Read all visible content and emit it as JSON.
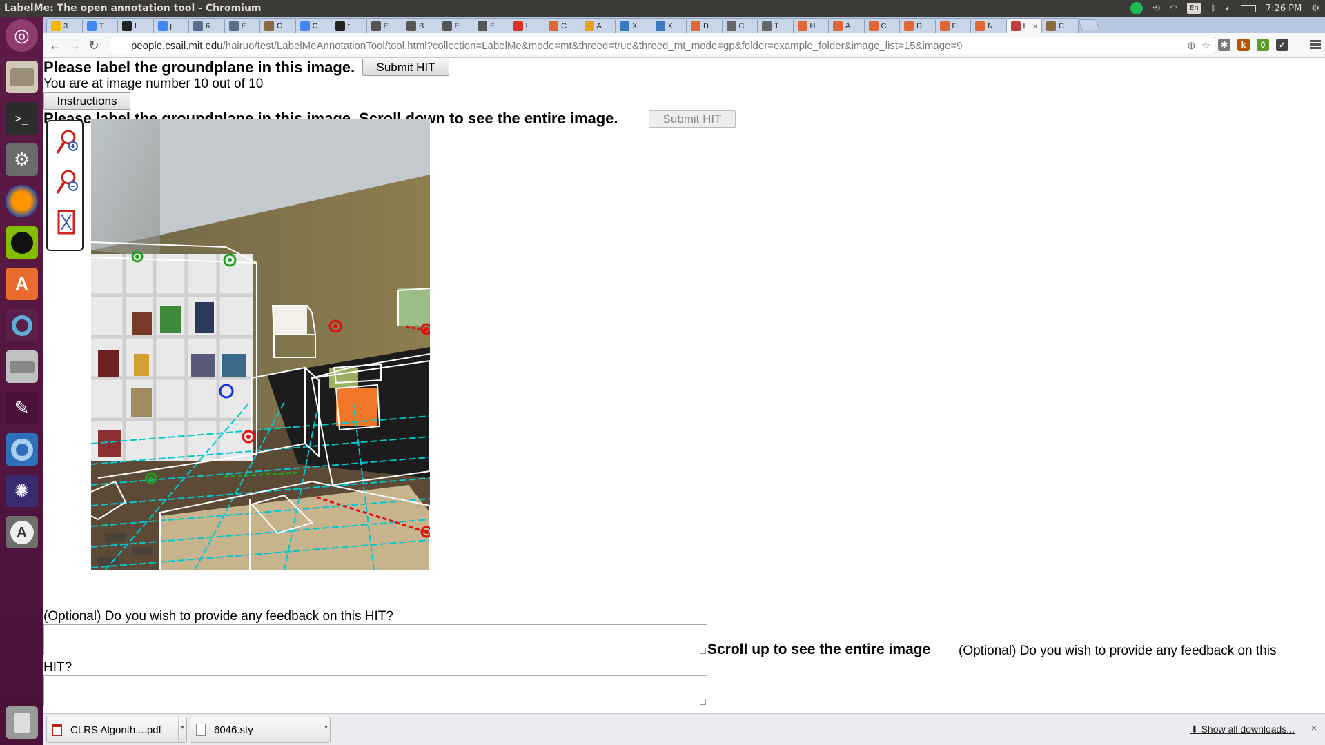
{
  "window": {
    "title": "LabelMe: The open annotation tool - Chromium",
    "clock": "7:26 PM",
    "keyboard_layout": "En"
  },
  "launcher": {
    "items": [
      "ubuntu-dash",
      "files",
      "terminal",
      "system-settings",
      "firefox",
      "spotify",
      "software-center",
      "unity-tweak",
      "disks",
      "text-editor",
      "chromium",
      "shotwell",
      "software-updater",
      "trash"
    ]
  },
  "tabs": [
    {
      "label": "3",
      "favicon": "drive"
    },
    {
      "label": "T",
      "favicon": "docs"
    },
    {
      "label": "L",
      "favicon": "github"
    },
    {
      "label": "j",
      "favicon": "docs"
    },
    {
      "label": "6",
      "favicon": "bookmark"
    },
    {
      "label": "E",
      "favicon": "bookmark"
    },
    {
      "label": "C",
      "favicon": "misc"
    },
    {
      "label": "C",
      "favicon": "docs"
    },
    {
      "label": "t",
      "favicon": "github"
    },
    {
      "label": "E",
      "favicon": "wiki"
    },
    {
      "label": "B",
      "favicon": "wiki"
    },
    {
      "label": "E",
      "favicon": "wiki"
    },
    {
      "label": "E",
      "favicon": "wiki"
    },
    {
      "label": "I",
      "favicon": "gmail"
    },
    {
      "label": "C",
      "favicon": "matlab"
    },
    {
      "label": "A",
      "favicon": "orange"
    },
    {
      "label": "X",
      "favicon": "w3"
    },
    {
      "label": "X",
      "favicon": "w3"
    },
    {
      "label": "D",
      "favicon": "matlab"
    },
    {
      "label": "C",
      "favicon": "wikipedia"
    },
    {
      "label": "T",
      "favicon": "wikipedia"
    },
    {
      "label": "H",
      "favicon": "matlab"
    },
    {
      "label": "A",
      "favicon": "matlab"
    },
    {
      "label": "C",
      "favicon": "matlab"
    },
    {
      "label": "D",
      "favicon": "matlab"
    },
    {
      "label": "F",
      "favicon": "matlab"
    },
    {
      "label": "N",
      "favicon": "matlab"
    },
    {
      "label": "L",
      "favicon": "labelme",
      "active": true
    },
    {
      "label": "C",
      "favicon": "misc"
    }
  ],
  "toolbar": {
    "url_host": "people.csail.mit.edu",
    "url_path": "/hairuo/test/LabelMeAnnotationTool/tool.html?collection=LabelMe&mode=mt&threed=true&threed_mt_mode=gp&folder=example_folder&image_list=15&image=9",
    "extension_badge": "0"
  },
  "page": {
    "heading_top": "Please label the groundplane in this image.",
    "submit_top": "Submit HIT",
    "image_counter": "You are at image number 10 out of 10",
    "instructions_button": "Instructions",
    "heading_scroll": "Please label the groundplane in this image. Scroll down to see the entire image.",
    "submit_disabled": "Submit HIT",
    "feedback_prompt_1": "(Optional) Do you wish to provide any feedback on this HIT?",
    "scroll_up": "Scroll up to see the entire image",
    "feedback_prompt_2_line1": "(Optional) Do you wish to provide any feedback on this",
    "feedback_prompt_2_line2": "HIT?",
    "tools": [
      "zoom-in-icon",
      "zoom-out-icon",
      "fit-image-icon"
    ]
  },
  "downloads": {
    "items": [
      {
        "name": "CLRS Algorith....pdf",
        "type": "pdf"
      },
      {
        "name": "6046.sty",
        "type": "file"
      }
    ],
    "show_all": "Show all downloads...",
    "close": "×"
  },
  "colors": {
    "launcher_bg": "#5e1b47",
    "panel_bg": "#3c3b37",
    "tabstrip_bg": "#b8c8e0",
    "annotation_box": "#ffffff",
    "groundplane_grid": "#00c8d2",
    "point_green": "#1fa01f",
    "point_red": "#e01010",
    "point_blue": "#1030e0"
  }
}
